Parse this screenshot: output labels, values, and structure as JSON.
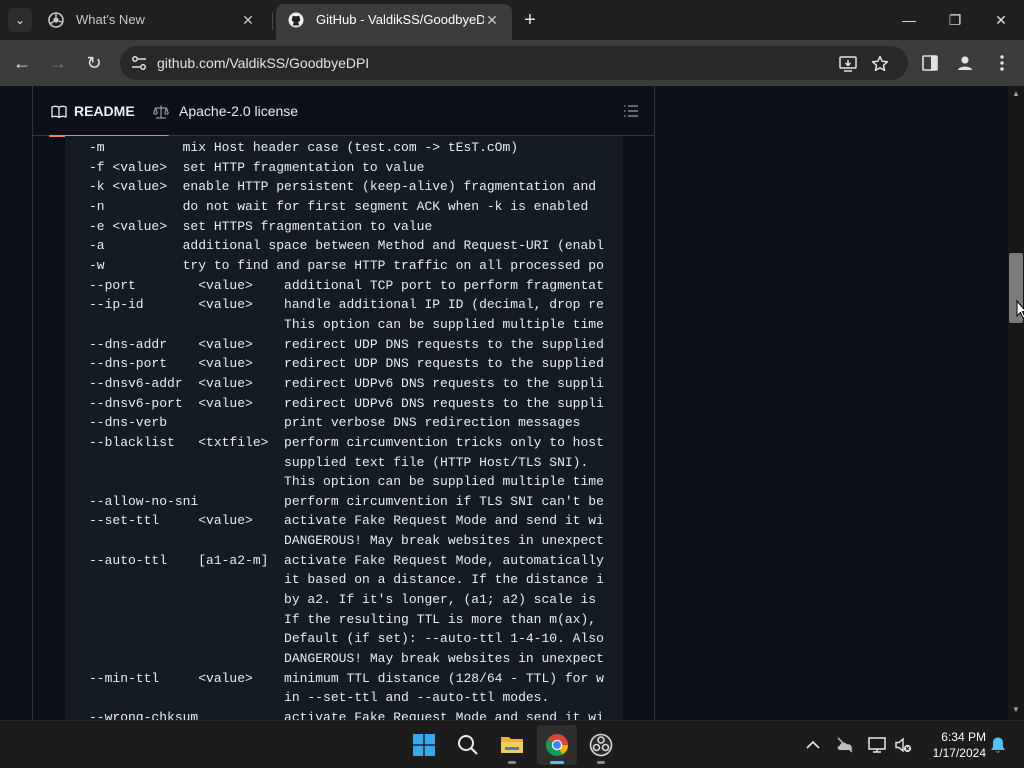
{
  "browser": {
    "tabs": [
      {
        "title": "What's New",
        "active": false
      },
      {
        "title": "GitHub - ValdikSS/GoodbyeDPI",
        "active": true
      }
    ],
    "address": "github.com/ValdikSS/GoodbyeDPI",
    "icons": {
      "tab_search": "chevron-down-icon",
      "new_tab": "plus-icon",
      "minimize": "minimize-icon",
      "maximize": "restore-icon",
      "close": "close-icon",
      "back": "back-arrow-icon",
      "forward": "forward-arrow-icon",
      "reload": "reload-icon",
      "site_info": "tune-icon",
      "install": "install-app-icon",
      "bookmark": "star-icon",
      "side_panel": "side-panel-icon",
      "profile": "profile-icon",
      "menu": "kebab-menu-icon"
    },
    "glyphs": {
      "tab_search": "⌄",
      "close": "✕",
      "new_tab": "+",
      "minimize": "—",
      "maximize": "❐",
      "win_close": "✕",
      "back": "←",
      "forward": "→",
      "reload": "↻"
    }
  },
  "readme": {
    "tabs": [
      {
        "label": "README",
        "icon": "book-icon",
        "active": true
      },
      {
        "label": "Apache-2.0 license",
        "icon": "law-scale-icon",
        "active": false
      }
    ],
    "outline_icon": "list-outline-icon",
    "code_lines": [
      "-m          mix Host header case (test.com -> tEsT.cOm)",
      "-f <value>  set HTTP fragmentation to value",
      "-k <value>  enable HTTP persistent (keep-alive) fragmentation and",
      "-n          do not wait for first segment ACK when -k is enabled",
      "-e <value>  set HTTPS fragmentation to value",
      "-a          additional space between Method and Request-URI (enabl",
      "-w          try to find and parse HTTP traffic on all processed po",
      "--port        <value>    additional TCP port to perform fragmentat",
      "--ip-id       <value>    handle additional IP ID (decimal, drop re",
      "                         This option can be supplied multiple time",
      "--dns-addr    <value>    redirect UDP DNS requests to the supplied",
      "--dns-port    <value>    redirect UDP DNS requests to the supplied",
      "--dnsv6-addr  <value>    redirect UDPv6 DNS requests to the suppli",
      "--dnsv6-port  <value>    redirect UDPv6 DNS requests to the suppli",
      "--dns-verb               print verbose DNS redirection messages",
      "--blacklist   <txtfile>  perform circumvention tricks only to host",
      "                         supplied text file (HTTP Host/TLS SNI).",
      "                         This option can be supplied multiple time",
      "--allow-no-sni           perform circumvention if TLS SNI can't be",
      "--set-ttl     <value>    activate Fake Request Mode and send it wi",
      "                         DANGEROUS! May break websites in unexpect",
      "--auto-ttl    [a1-a2-m]  activate Fake Request Mode, automatically",
      "                         it based on a distance. If the distance i",
      "                         by a2. If it's longer, (a1; a2) scale is",
      "                         If the resulting TTL is more than m(ax),",
      "                         Default (if set): --auto-ttl 1-4-10. Also",
      "                         DANGEROUS! May break websites in unexpect",
      "--min-ttl     <value>    minimum TTL distance (128/64 - TTL) for w",
      "                         in --set-ttl and --auto-ttl modes.",
      "--wrong-chksum           activate Fake Request Mode and send it wi"
    ]
  },
  "scrollbar": {
    "up": "▲",
    "down": "▼"
  },
  "taskbar": {
    "apps": [
      {
        "name": "windows-start-icon",
        "active": false
      },
      {
        "name": "search-icon",
        "active": false
      },
      {
        "name": "file-explorer-icon",
        "active": false
      },
      {
        "name": "chrome-icon",
        "active": true
      },
      {
        "name": "obs-studio-icon",
        "active": false
      }
    ],
    "tray": [
      "chevron-up-icon",
      "cloud-offline-icon",
      "display-icon",
      "volume-muted-icon",
      "notification-bell-icon"
    ],
    "time": "6:34 PM",
    "date": "1/17/2024"
  },
  "colors": {
    "accent_underline": "#f78166",
    "taskbar_active": "#4cc2ff",
    "page_bg": "#0d1117",
    "code_bg": "#151b23"
  }
}
